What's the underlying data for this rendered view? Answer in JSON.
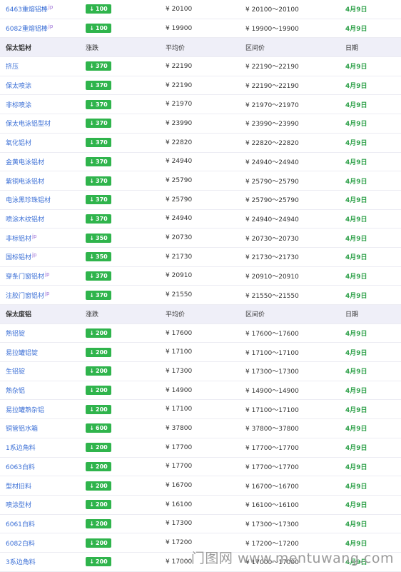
{
  "top_rows": [
    {
      "name": "6463重熔铝棒",
      "change": "100",
      "avg": "¥ 20100",
      "range": "¥ 20100～20100",
      "date": "4月9日",
      "mark": "jp"
    },
    {
      "name": "6082重熔铝棒",
      "change": "100",
      "avg": "¥ 19900",
      "range": "¥ 19900～19900",
      "date": "4月9日",
      "mark": "jp"
    }
  ],
  "sections": [
    {
      "header": {
        "name": "保太铝材",
        "change": "涨跌",
        "avg": "平均价",
        "range": "区间价",
        "date": "日期"
      },
      "rows": [
        {
          "name": "挤压",
          "change": "370",
          "avg": "¥ 22190",
          "range": "¥ 22190～22190",
          "date": "4月9日"
        },
        {
          "name": "保太喷涂",
          "change": "370",
          "avg": "¥ 22190",
          "range": "¥ 22190～22190",
          "date": "4月9日"
        },
        {
          "name": "非标喷涂",
          "change": "370",
          "avg": "¥ 21970",
          "range": "¥ 21970～21970",
          "date": "4月9日"
        },
        {
          "name": "保太电泳铝型材",
          "change": "370",
          "avg": "¥ 23990",
          "range": "¥ 23990～23990",
          "date": "4月9日"
        },
        {
          "name": "氧化铝材",
          "change": "370",
          "avg": "¥ 22820",
          "range": "¥ 22820～22820",
          "date": "4月9日"
        },
        {
          "name": "金黄电泳铝材",
          "change": "370",
          "avg": "¥ 24940",
          "range": "¥ 24940～24940",
          "date": "4月9日"
        },
        {
          "name": "紫铜电泳铝材",
          "change": "370",
          "avg": "¥ 25790",
          "range": "¥ 25790～25790",
          "date": "4月9日"
        },
        {
          "name": "电泳黑珍珠铝材",
          "change": "370",
          "avg": "¥ 25790",
          "range": "¥ 25790～25790",
          "date": "4月9日"
        },
        {
          "name": "喷涂木纹铝材",
          "change": "370",
          "avg": "¥ 24940",
          "range": "¥ 24940～24940",
          "date": "4月9日"
        },
        {
          "name": "非标铝材",
          "change": "350",
          "avg": "¥ 20730",
          "range": "¥ 20730～20730",
          "date": "4月9日",
          "mark": "jp"
        },
        {
          "name": "国标铝材",
          "change": "350",
          "avg": "¥ 21730",
          "range": "¥ 21730～21730",
          "date": "4月9日",
          "mark": "jp"
        },
        {
          "name": "穿条门窗铝材",
          "change": "370",
          "avg": "¥ 20910",
          "range": "¥ 20910～20910",
          "date": "4月9日",
          "mark": "jp"
        },
        {
          "name": "注胶门窗铝材",
          "change": "370",
          "avg": "¥ 21550",
          "range": "¥ 21550～21550",
          "date": "4月9日",
          "mark": "jp"
        }
      ]
    },
    {
      "header": {
        "name": "保太废铝",
        "change": "涨跌",
        "avg": "平均价",
        "range": "区间价",
        "date": "日期"
      },
      "rows": [
        {
          "name": "熟铝锭",
          "change": "200",
          "avg": "¥ 17600",
          "range": "¥ 17600～17600",
          "date": "4月9日"
        },
        {
          "name": "易拉罐铝锭",
          "change": "200",
          "avg": "¥ 17100",
          "range": "¥ 17100～17100",
          "date": "4月9日"
        },
        {
          "name": "生铝锭",
          "change": "200",
          "avg": "¥ 17300",
          "range": "¥ 17300～17300",
          "date": "4月9日"
        },
        {
          "name": "熟杂铝",
          "change": "200",
          "avg": "¥ 14900",
          "range": "¥ 14900～14900",
          "date": "4月9日"
        },
        {
          "name": "易拉罐熟杂铝",
          "change": "200",
          "avg": "¥ 17100",
          "range": "¥ 17100～17100",
          "date": "4月9日"
        },
        {
          "name": "铜管铝水箱",
          "change": "600",
          "avg": "¥ 37800",
          "range": "¥ 37800～37800",
          "date": "4月9日"
        },
        {
          "name": "1系边角料",
          "change": "200",
          "avg": "¥ 17700",
          "range": "¥ 17700～17700",
          "date": "4月9日"
        },
        {
          "name": "6063白料",
          "change": "200",
          "avg": "¥ 17700",
          "range": "¥ 17700～17700",
          "date": "4月9日"
        },
        {
          "name": "型材旧料",
          "change": "200",
          "avg": "¥ 16700",
          "range": "¥ 16700～16700",
          "date": "4月9日"
        },
        {
          "name": "喷涂型材",
          "change": "200",
          "avg": "¥ 16100",
          "range": "¥ 16100～16100",
          "date": "4月9日"
        },
        {
          "name": "6061白料",
          "change": "200",
          "avg": "¥ 17300",
          "range": "¥ 17300～17300",
          "date": "4月9日"
        },
        {
          "name": "6082白料",
          "change": "200",
          "avg": "¥ 17200",
          "range": "¥ 17200～17200",
          "date": "4月9日"
        },
        {
          "name": "3系边角料",
          "change": "200",
          "avg": "¥ 17000",
          "range": "¥ 17000～17000",
          "date": "4月9日"
        }
      ]
    }
  ],
  "arrow_icon": "↓",
  "watermark": "门图网 www.mentuwang.com",
  "colors": {
    "link": "#3b6fd6",
    "badge": "#2fb44c",
    "date": "#2fa14a",
    "header_bg": "#efeff8"
  }
}
